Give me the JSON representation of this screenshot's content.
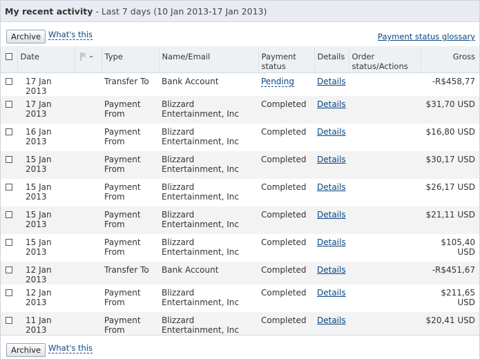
{
  "header": {
    "title": "My recent activity",
    "range": "- Last 7 days (10 Jan 2013-17 Jan 2013)"
  },
  "toolbar": {
    "archive_label": "Archive",
    "whats_this": "What's this",
    "glossary": "Payment status glossary"
  },
  "columns": {
    "date": "Date",
    "type": "Type",
    "name": "Name/Email",
    "status": "Payment status",
    "details": "Details",
    "order": "Order status/Actions",
    "gross": "Gross"
  },
  "rows": [
    {
      "date": "17 Jan 2013",
      "type": "Transfer To",
      "name": "Bank Account",
      "status": "Pending",
      "details": "Details",
      "gross": "-R$458,77"
    },
    {
      "date": "17 Jan 2013",
      "type": "Payment From",
      "name": "Blizzard Entertainment, Inc",
      "status": "Completed",
      "details": "Details",
      "gross": "$31,70 USD"
    },
    {
      "date": "16 Jan 2013",
      "type": "Payment From",
      "name": "Blizzard Entertainment, Inc",
      "status": "Completed",
      "details": "Details",
      "gross": "$16,80 USD"
    },
    {
      "date": "15 Jan 2013",
      "type": "Payment From",
      "name": "Blizzard Entertainment, Inc",
      "status": "Completed",
      "details": "Details",
      "gross": "$30,17 USD"
    },
    {
      "date": "15 Jan 2013",
      "type": "Payment From",
      "name": "Blizzard Entertainment, Inc",
      "status": "Completed",
      "details": "Details",
      "gross": "$26,17 USD"
    },
    {
      "date": "15 Jan 2013",
      "type": "Payment From",
      "name": "Blizzard Entertainment, Inc",
      "status": "Completed",
      "details": "Details",
      "gross": "$21,11 USD"
    },
    {
      "date": "15 Jan 2013",
      "type": "Payment From",
      "name": "Blizzard Entertainment, Inc",
      "status": "Completed",
      "details": "Details",
      "gross": "$105,40 USD"
    },
    {
      "date": "12 Jan 2013",
      "type": "Transfer To",
      "name": "Bank Account",
      "status": "Completed",
      "details": "Details",
      "gross": "-R$451,67"
    },
    {
      "date": "12 Jan 2013",
      "type": "Payment From",
      "name": "Blizzard Entertainment, Inc",
      "status": "Completed",
      "details": "Details",
      "gross": "$211,65 USD"
    },
    {
      "date": "11 Jan 2013",
      "type": "Payment From",
      "name": "Blizzard Entertainment, Inc",
      "status": "Completed",
      "details": "Details",
      "gross": "$20,41 USD"
    }
  ],
  "footer": {
    "archive_label": "Archive",
    "whats_this": "What's this"
  },
  "colors": {
    "link": "#084482",
    "header_bg": "#e8ecf1",
    "row_alt_bg": "#f3f3f3"
  }
}
